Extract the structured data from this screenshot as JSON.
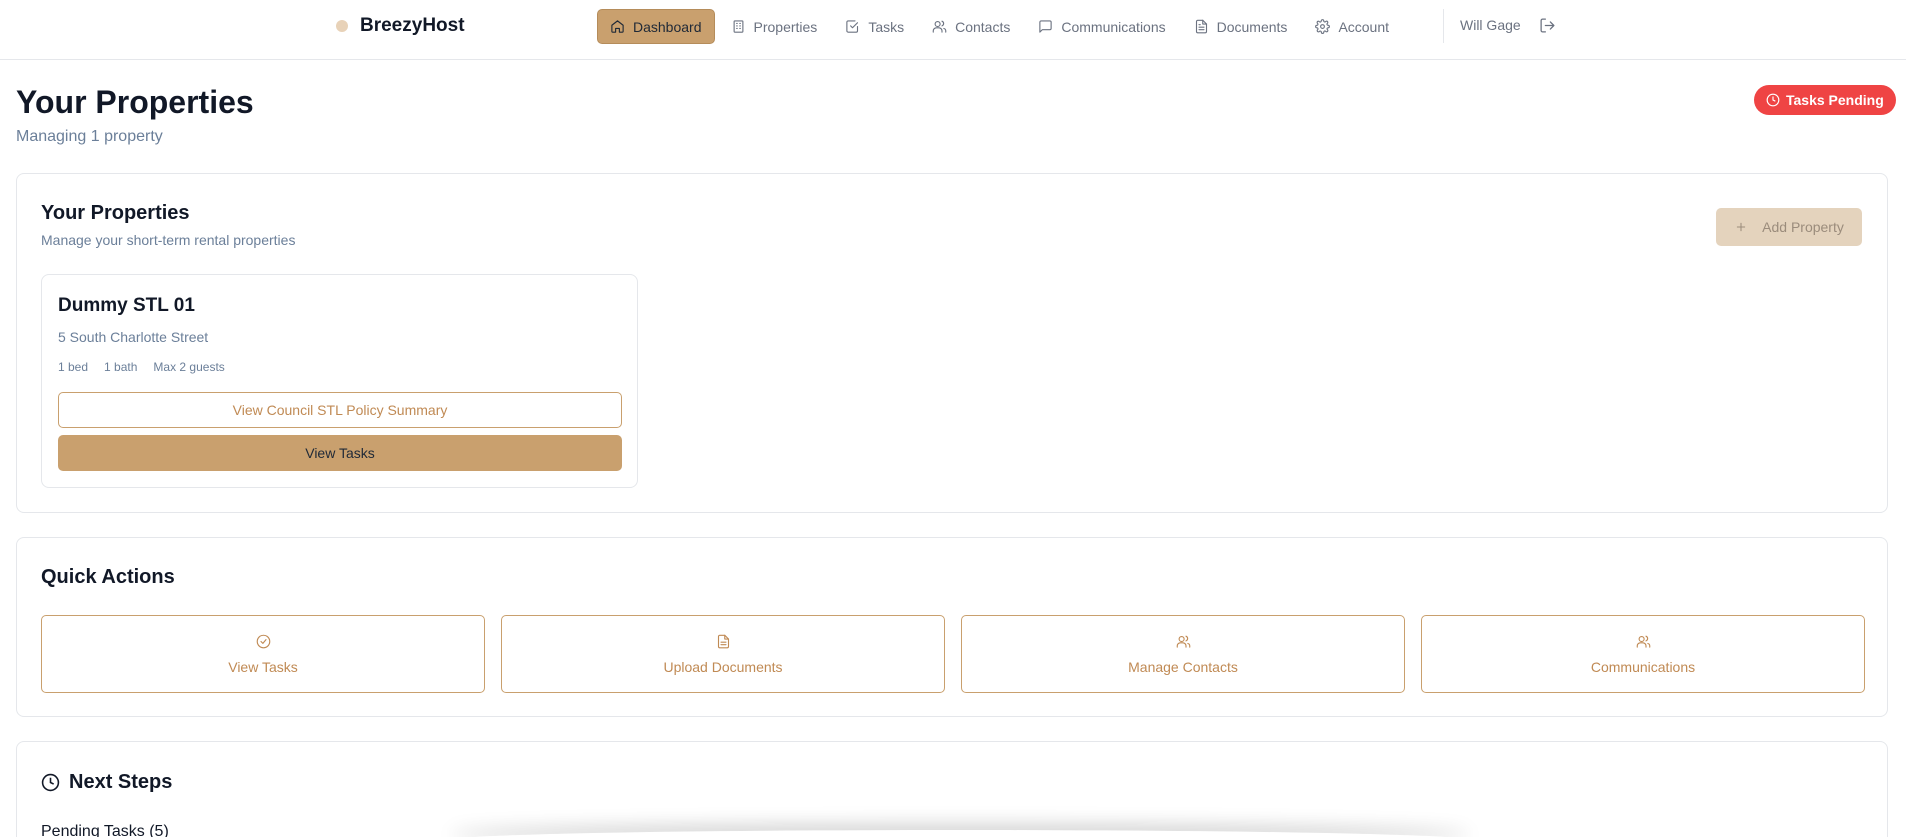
{
  "brand": {
    "name": "BreezyHost"
  },
  "nav": {
    "items": [
      {
        "label": "Dashboard",
        "icon": "home-icon"
      },
      {
        "label": "Properties",
        "icon": "building-icon"
      },
      {
        "label": "Tasks",
        "icon": "check-square-icon"
      },
      {
        "label": "Contacts",
        "icon": "users-icon"
      },
      {
        "label": "Communications",
        "icon": "message-icon"
      },
      {
        "label": "Documents",
        "icon": "file-icon"
      },
      {
        "label": "Account",
        "icon": "gear-icon"
      }
    ],
    "active": "Dashboard"
  },
  "user": {
    "name": "Will Gage"
  },
  "header": {
    "title": "Your Properties",
    "subtitle": "Managing 1 property",
    "badge": "Tasks Pending"
  },
  "properties_section": {
    "title": "Your Properties",
    "description": "Manage your short-term rental properties",
    "add_button": "Add Property",
    "properties": [
      {
        "name": "Dummy STL 01",
        "address": "5 South Charlotte Street",
        "beds": "1 bed",
        "baths": "1 bath",
        "guests": "Max 2 guests",
        "policy_button": "View Council STL Policy Summary",
        "tasks_button": "View Tasks"
      }
    ]
  },
  "quick_actions": {
    "title": "Quick Actions",
    "items": [
      {
        "label": "View Tasks",
        "icon": "check-circle-icon"
      },
      {
        "label": "Upload Documents",
        "icon": "file-icon"
      },
      {
        "label": "Manage Contacts",
        "icon": "users-icon"
      },
      {
        "label": "Communications",
        "icon": "users-icon"
      }
    ]
  },
  "next_steps": {
    "title": "Next Steps",
    "pending_tasks": "Pending Tasks (5)"
  },
  "colors": {
    "accent": "#c9a06e",
    "accent_text": "#c08a54",
    "badge": "#ef4444",
    "muted_text": "#6b7f99"
  }
}
